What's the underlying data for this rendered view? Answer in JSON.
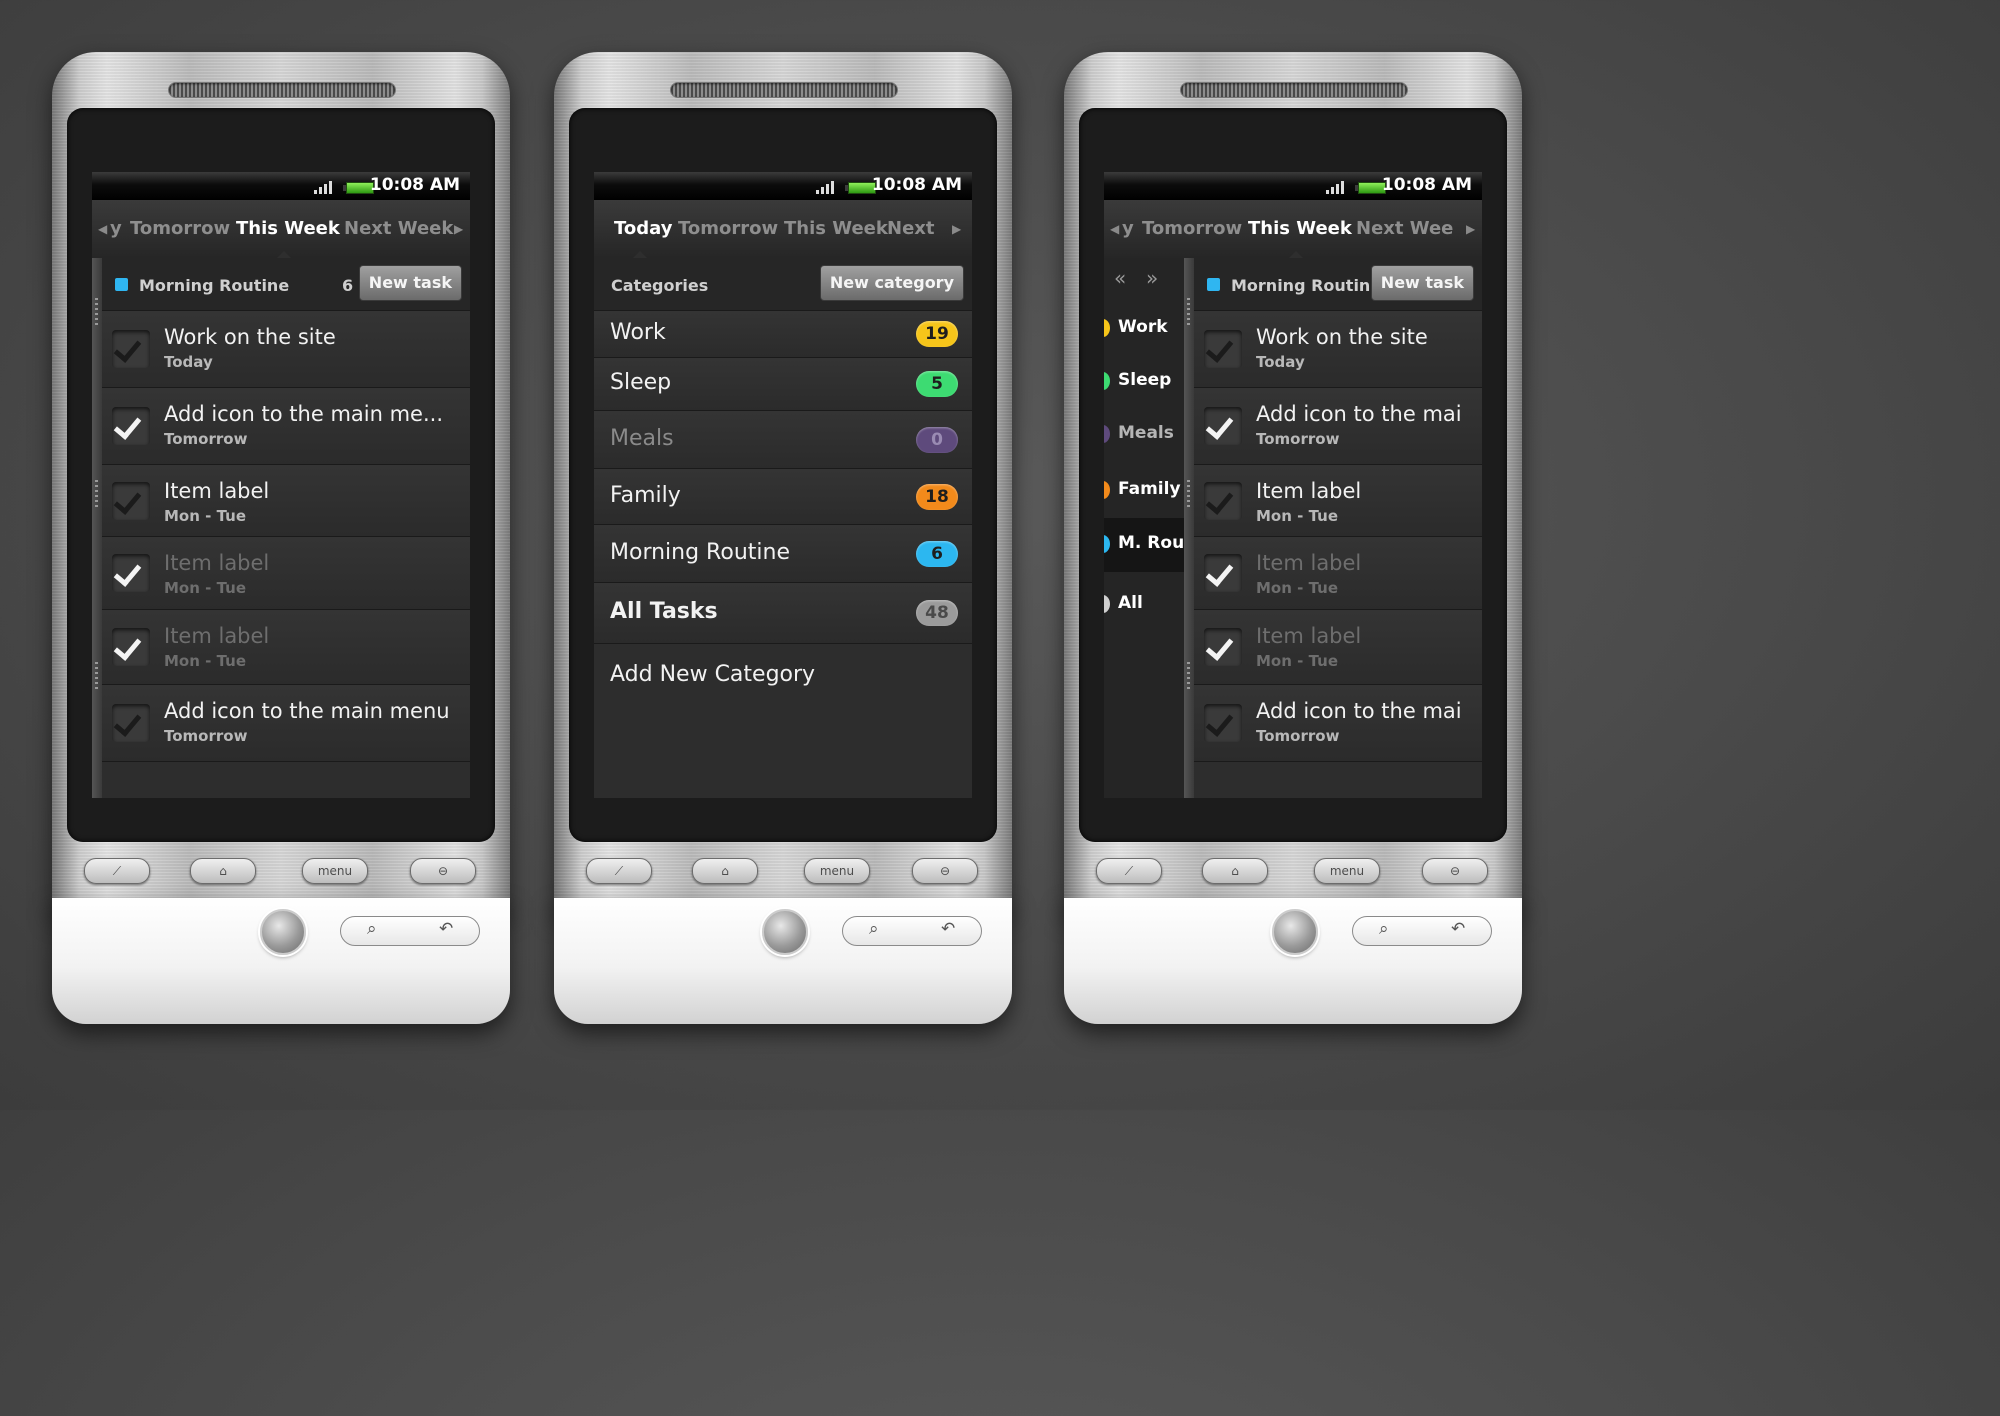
{
  "status": {
    "time": "10:08 AM"
  },
  "phone1": {
    "tabs": [
      "y",
      "Tomorrow",
      "This Week",
      "Next Week"
    ],
    "active_tab": "This Week",
    "header": {
      "label": "Morning Routine",
      "count": "6",
      "button": "New task"
    },
    "tasks": [
      {
        "title": "Work on the site",
        "sub": "Today",
        "checked": false,
        "dim": false
      },
      {
        "title": "Add icon to the main me...",
        "sub": "Tomorrow",
        "checked": true,
        "dim": false
      },
      {
        "title": "Item label",
        "sub": "Mon - Tue",
        "checked": false,
        "dim": false
      },
      {
        "title": "Item label",
        "sub": "Mon - Tue",
        "checked": true,
        "dim": true
      },
      {
        "title": "Item label",
        "sub": "Mon - Tue",
        "checked": true,
        "dim": true
      },
      {
        "title": "Add icon to the main menu",
        "sub": "Tomorrow",
        "checked": false,
        "dim": false
      }
    ]
  },
  "phone2": {
    "tabs": [
      "Today",
      "Tomorrow",
      "This Week",
      "Next"
    ],
    "active_tab": "Today",
    "header": {
      "label": "Categories",
      "button": "New category"
    },
    "categories": [
      {
        "name": "Work",
        "count": "19",
        "color": "#f6c51a"
      },
      {
        "name": "Sleep",
        "count": "5",
        "color": "#3ddb72"
      },
      {
        "name": "Meals",
        "count": "0",
        "color": "#5e4a7c"
      },
      {
        "name": "Family",
        "count": "18",
        "color": "#f28a1b"
      },
      {
        "name": "Morning Routine",
        "count": "6",
        "color": "#2cb7f0"
      }
    ],
    "all_tasks": {
      "name": "All Tasks",
      "count": "48",
      "color": "#9b9b9b"
    },
    "add_new": "Add New Category"
  },
  "phone3": {
    "tabs": [
      "y",
      "Tomorrow",
      "This Week",
      "Next Wee"
    ],
    "active_tab": "This Week",
    "side_arrows": [
      "«",
      "»"
    ],
    "side": [
      {
        "name": "Work",
        "color": "#f6c51a",
        "selected": false
      },
      {
        "name": "Sleep",
        "color": "#3ddb72",
        "selected": false
      },
      {
        "name": "Meals",
        "color": "#5e4a7c",
        "selected": false
      },
      {
        "name": "Family",
        "color": "#f28a1b",
        "selected": false
      },
      {
        "name": "M. Rou",
        "color": "#2cb7f0",
        "selected": true
      },
      {
        "name": "All",
        "color": "#cfcfcf",
        "selected": false
      }
    ],
    "header": {
      "label": "Morning Routine",
      "button": "New task"
    },
    "tasks": [
      {
        "title": "Work on the site",
        "sub": "Today",
        "checked": false,
        "dim": false
      },
      {
        "title": "Add icon to the mai",
        "sub": "Tomorrow",
        "checked": true,
        "dim": false
      },
      {
        "title": "Item label",
        "sub": "Mon - Tue",
        "checked": false,
        "dim": false
      },
      {
        "title": "Item label",
        "sub": "Mon - Tue",
        "checked": true,
        "dim": true
      },
      {
        "title": "Item label",
        "sub": "Mon - Tue",
        "checked": true,
        "dim": true
      },
      {
        "title": "Add icon to the mai",
        "sub": "Tomorrow",
        "checked": false,
        "dim": false
      }
    ]
  },
  "hardware": {
    "menu_label": "menu"
  }
}
